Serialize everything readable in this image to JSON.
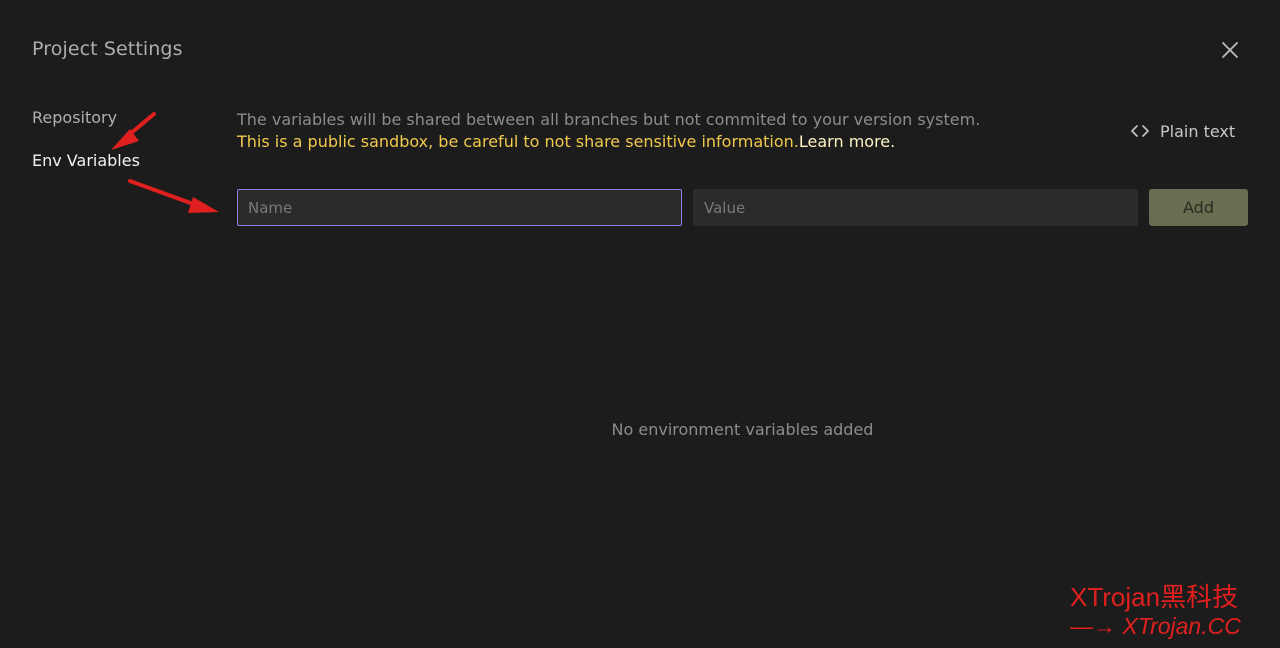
{
  "modal": {
    "title": "Project Settings",
    "close_icon": "close-icon"
  },
  "sidebar": {
    "items": [
      {
        "label": "Repository",
        "active": false
      },
      {
        "label": "Env Variables",
        "active": true
      }
    ]
  },
  "main": {
    "description": "The variables will be shared between all branches but not commited to your version system.",
    "warning": "This is a public sandbox, be careful to not share sensitive information.",
    "learn_more": "Learn more.",
    "plain_text_label": "Plain text",
    "plain_text_icon": "code-icon",
    "name_field": {
      "placeholder": "Name",
      "value": ""
    },
    "value_field": {
      "placeholder": "Value",
      "value": ""
    },
    "add_label": "Add",
    "empty_state": "No environment variables added"
  },
  "watermark": {
    "line1": "XTrojan黑科技",
    "line2": "—→ XTrojan.CC"
  },
  "colors": {
    "background": "#1c1c1c",
    "input_background": "#2b2b2b",
    "focus_border": "#8a7ef0",
    "warning_text": "#f2c94c",
    "add_button": "#6a6d4f",
    "annotation_red": "#e0201e"
  }
}
